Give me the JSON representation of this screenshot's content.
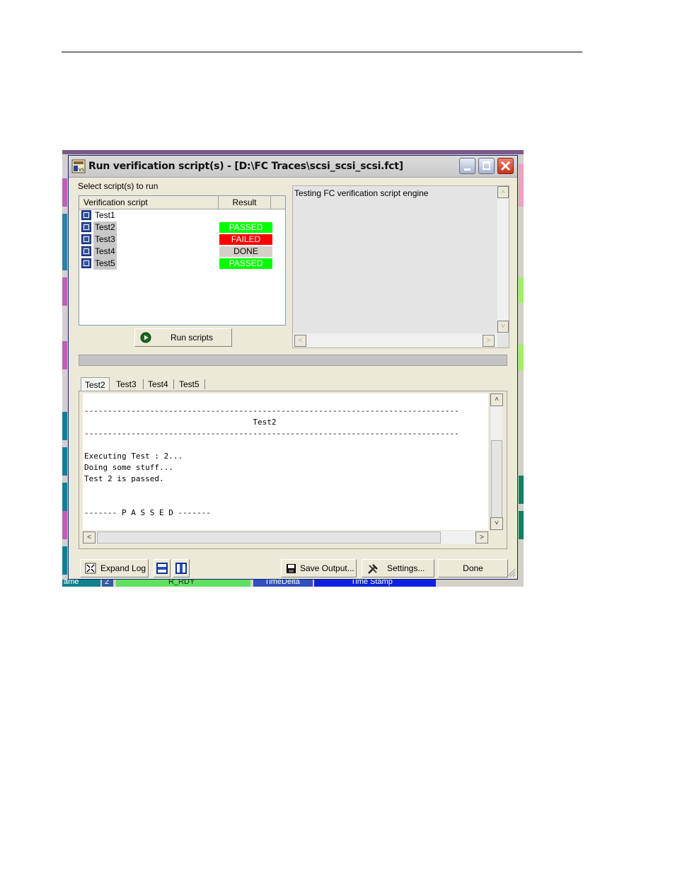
{
  "dialog": {
    "title": "Run verification script(s) - [D:\\FC Traces\\scsi_scsi_scsi.fct]",
    "select_label": "Select script(s) to run",
    "columns": {
      "script": "Verification script",
      "result": "Result"
    },
    "scripts": [
      {
        "name": "Test1",
        "result": "",
        "result_color": "",
        "selected": false
      },
      {
        "name": "Test2",
        "result": "PASSED",
        "result_color": "#00ff00",
        "selected": true
      },
      {
        "name": "Test3",
        "result": "FAILED",
        "result_color": "#ff0000",
        "selected": true
      },
      {
        "name": "Test4",
        "result": "DONE",
        "result_color": "#d4d0c8",
        "selected": true
      },
      {
        "name": "Test5",
        "result": "PASSED",
        "result_color": "#00ff00",
        "selected": true
      }
    ],
    "run_button": "Run scripts",
    "output_text": "Testing FC verification script engine",
    "tabs": [
      "Test2",
      "Test3",
      "Test4",
      "Test5"
    ],
    "active_tab": "Test2",
    "log_lines": [
      "--------------------------------------------------------------------------------",
      "                                    Test2",
      "--------------------------------------------------------------------------------",
      "",
      "",
      "Executing Test : 2...",
      "Doing some stuff...",
      "Test 2 is passed.",
      "",
      "",
      "------- P A S S E D -------"
    ],
    "footer": {
      "expand_log": "Expand Log",
      "save_output": "Save Output...",
      "settings": "Settings...",
      "done": "Done"
    }
  },
  "background_app": {
    "labels": [
      "ame",
      "2",
      "R_RDY",
      "TimeDelta",
      "Time Stamp"
    ]
  },
  "colors": {
    "passed": "#00ff00",
    "failed": "#ff0000",
    "done": "#d4d0c8"
  }
}
